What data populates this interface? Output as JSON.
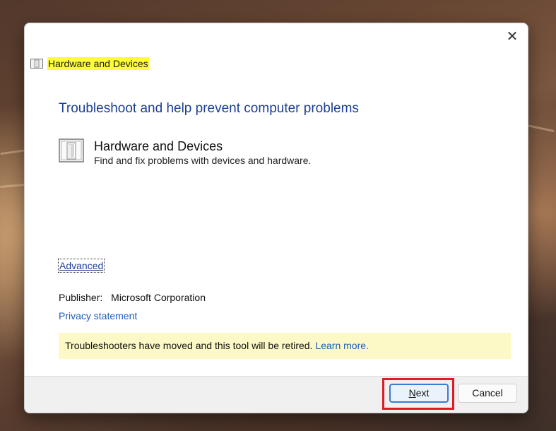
{
  "window": {
    "title": "Hardware and Devices",
    "close_glyph": "✕"
  },
  "main": {
    "heading": "Troubleshoot and help prevent computer problems",
    "item": {
      "title": "Hardware and Devices",
      "description": "Find and fix problems with devices and hardware."
    },
    "advanced_link": "Advanced",
    "publisher_label": "Publisher:",
    "publisher_value": "Microsoft Corporation",
    "privacy_link": "Privacy statement",
    "banner": {
      "text": "Troubleshooters have moved and this tool will be retired.",
      "link": "Learn more."
    }
  },
  "footer": {
    "next_label_rest": "ext",
    "next_label_accel": "N",
    "cancel_label": "Cancel"
  },
  "colors": {
    "heading_blue": "#1c3f94",
    "link_blue": "#1c5fb5",
    "banner_bg": "#fcf9c6",
    "title_highlight": "#ffff33",
    "annotation_red": "#e01b24"
  },
  "icons": [
    "hardware-devices-icon",
    "close-icon"
  ]
}
